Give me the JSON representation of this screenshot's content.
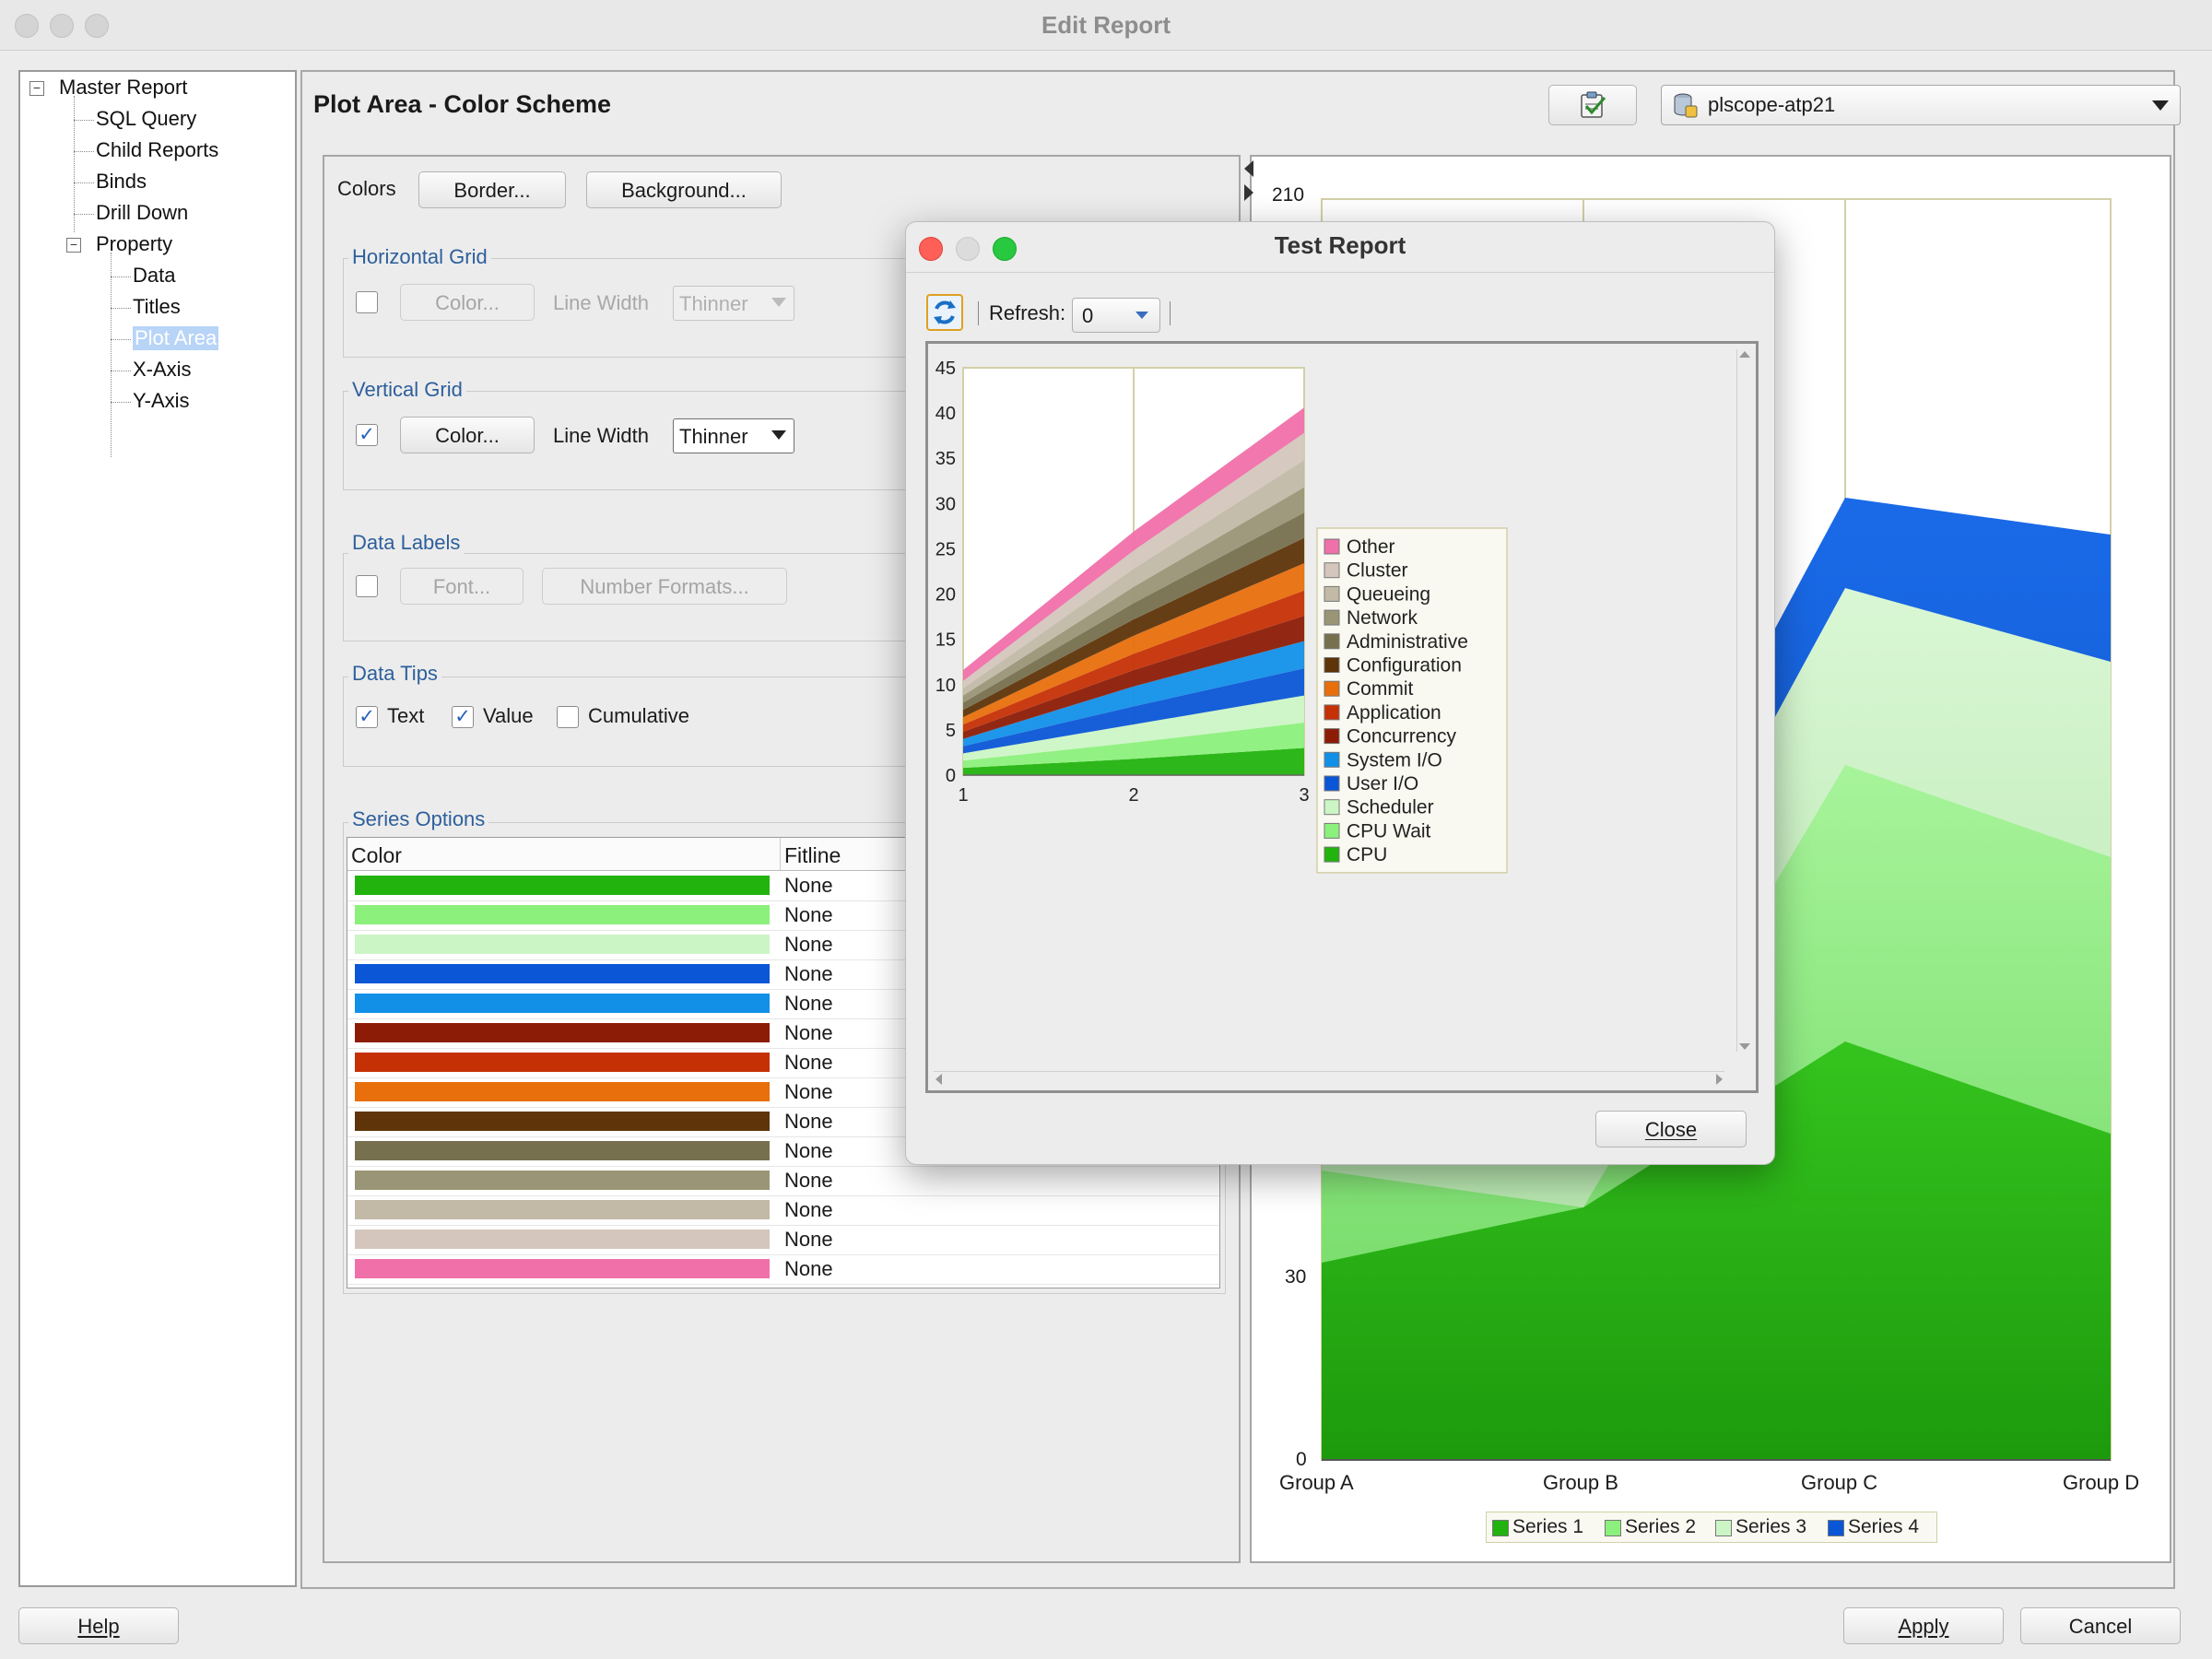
{
  "window": {
    "title": "Edit Report"
  },
  "tree": {
    "items": [
      {
        "label": "Master Report",
        "level": 0,
        "expandable": true
      },
      {
        "label": "SQL Query",
        "level": 1
      },
      {
        "label": "Child Reports",
        "level": 1
      },
      {
        "label": "Binds",
        "level": 1
      },
      {
        "label": "Drill Down",
        "level": 1
      },
      {
        "label": "Property",
        "level": 1,
        "expandable": true
      },
      {
        "label": "Data",
        "level": 2
      },
      {
        "label": "Titles",
        "level": 2
      },
      {
        "label": "Plot Area",
        "level": 2,
        "selected": true
      },
      {
        "label": "X-Axis",
        "level": 2
      },
      {
        "label": "Y-Axis",
        "level": 2
      }
    ],
    "toggle_glyph": "−"
  },
  "main": {
    "title": "Plot Area - Color Scheme",
    "connection": "plscope-atp21"
  },
  "colors_section": {
    "label": "Colors",
    "border_button": "Border...",
    "background_button": "Background..."
  },
  "horizontal_grid": {
    "title": "Horizontal Grid",
    "checked": false,
    "color_button": "Color...",
    "line_width_label": "Line Width",
    "line_width_value": "Thinner"
  },
  "vertical_grid": {
    "title": "Vertical Grid",
    "checked": true,
    "color_button": "Color...",
    "line_width_label": "Line Width",
    "line_width_value": "Thinner"
  },
  "data_labels": {
    "title": "Data Labels",
    "checked": false,
    "font_button": "Font...",
    "number_formats_button": "Number Formats..."
  },
  "data_tips": {
    "title": "Data Tips",
    "text_label": "Text",
    "text_checked": true,
    "value_label": "Value",
    "value_checked": true,
    "cumulative_label": "Cumulative",
    "cumulative_checked": false
  },
  "series_options": {
    "title": "Series Options",
    "columns": [
      "Color",
      "Fitline"
    ],
    "rows": [
      {
        "color": "#22b30e",
        "fitline": "None"
      },
      {
        "color": "#8cf07c",
        "fitline": "None"
      },
      {
        "color": "#ccf5c5",
        "fitline": "None"
      },
      {
        "color": "#0a56d6",
        "fitline": "None"
      },
      {
        "color": "#1290e8",
        "fitline": "None"
      },
      {
        "color": "#8c1c06",
        "fitline": "None"
      },
      {
        "color": "#c63005",
        "fitline": "None"
      },
      {
        "color": "#e86f0c",
        "fitline": "None"
      },
      {
        "color": "#5e3408",
        "fitline": "None"
      },
      {
        "color": "#76704f",
        "fitline": "None"
      },
      {
        "color": "#9a9576",
        "fitline": "None"
      },
      {
        "color": "#c2b9a6",
        "fitline": "None"
      },
      {
        "color": "#d4c6bd",
        "fitline": "None"
      },
      {
        "color": "#f070aa",
        "fitline": "None"
      }
    ]
  },
  "preview_chart": {
    "y_ticks": [
      "210",
      "30",
      "0"
    ],
    "x_labels": [
      "Group A",
      "Group B",
      "Group C",
      "Group D"
    ],
    "legend": [
      {
        "name": "Series 1",
        "color": "#22b30e"
      },
      {
        "name": "Series 2",
        "color": "#8cf07c"
      },
      {
        "name": "Series 3",
        "color": "#ccf5c5"
      },
      {
        "name": "Series 4",
        "color": "#0a56d6"
      }
    ]
  },
  "dialog": {
    "title": "Test Report",
    "refresh_label": "Refresh:",
    "refresh_value": "0",
    "close_button": "Close"
  },
  "chart_data": {
    "type": "area",
    "stacked": true,
    "x": [
      1,
      2,
      3
    ],
    "ylim": [
      0,
      45
    ],
    "y_ticks": [
      0,
      5,
      10,
      15,
      20,
      25,
      30,
      35,
      40,
      45
    ],
    "vertical_grid": true,
    "legend_position": "right",
    "series": [
      {
        "name": "CPU",
        "color": "#22b30e",
        "values": [
          0.8,
          1.8,
          3.0
        ]
      },
      {
        "name": "CPU Wait",
        "color": "#8cf07c",
        "values": [
          0.8,
          1.8,
          2.8
        ]
      },
      {
        "name": "Scheduler",
        "color": "#ccf5c5",
        "values": [
          0.8,
          2.0,
          3.0
        ]
      },
      {
        "name": "User I/O",
        "color": "#0a56d6",
        "values": [
          0.8,
          2.0,
          3.0
        ]
      },
      {
        "name": "System I/O",
        "color": "#1290e8",
        "values": [
          0.8,
          2.2,
          3.0
        ]
      },
      {
        "name": "Concurrency",
        "color": "#8c1c06",
        "values": [
          0.8,
          1.8,
          2.8
        ]
      },
      {
        "name": "Application",
        "color": "#c63005",
        "values": [
          0.8,
          1.8,
          2.8
        ]
      },
      {
        "name": "Commit",
        "color": "#e86f0c",
        "values": [
          0.8,
          2.0,
          3.0
        ]
      },
      {
        "name": "Configuration",
        "color": "#5e3408",
        "values": [
          0.8,
          1.8,
          2.8
        ]
      },
      {
        "name": "Administrative",
        "color": "#76704f",
        "values": [
          0.8,
          1.8,
          2.8
        ]
      },
      {
        "name": "Network",
        "color": "#9a9576",
        "values": [
          0.8,
          1.8,
          2.8
        ]
      },
      {
        "name": "Queueing",
        "color": "#c2b9a6",
        "values": [
          0.8,
          2.0,
          3.0
        ]
      },
      {
        "name": "Cluster",
        "color": "#d4c6bd",
        "values": [
          0.8,
          2.0,
          3.0
        ]
      },
      {
        "name": "Other",
        "color": "#f070aa",
        "values": [
          1.2,
          2.1,
          2.8
        ]
      }
    ]
  },
  "footer": {
    "help_button": "Help",
    "apply_button": "Apply",
    "cancel_button": "Cancel"
  }
}
